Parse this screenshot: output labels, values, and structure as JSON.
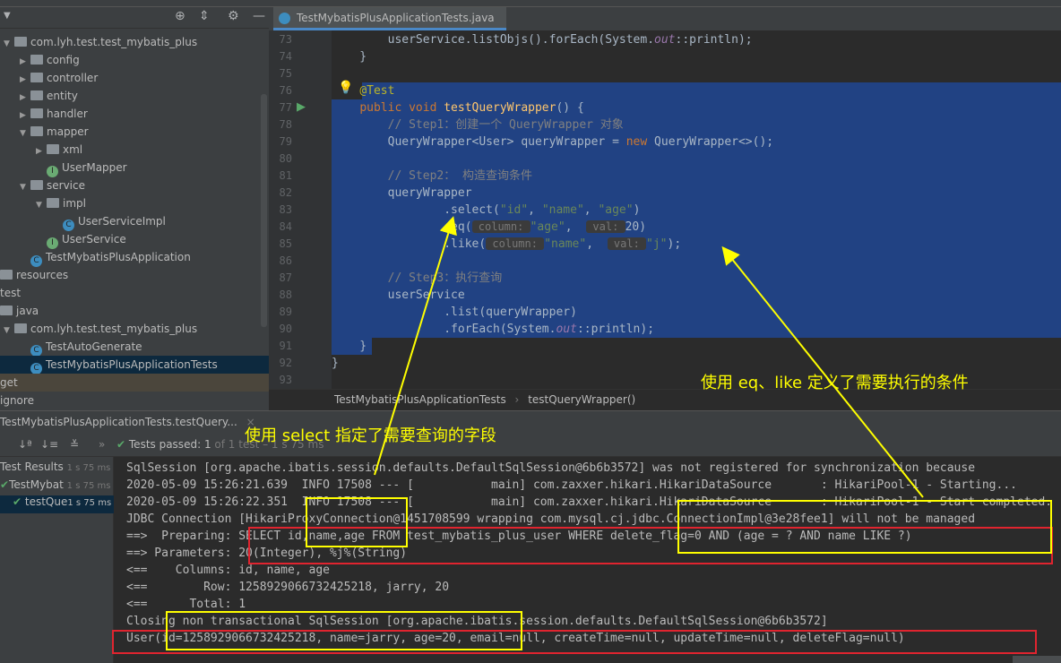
{
  "project": {
    "items": [
      {
        "label": "com.lyh.test.test_mybatis_plus",
        "depth": 0,
        "icon": "folder",
        "open": true
      },
      {
        "label": "config",
        "depth": 1,
        "icon": "folder"
      },
      {
        "label": "controller",
        "depth": 1,
        "icon": "folder"
      },
      {
        "label": "entity",
        "depth": 1,
        "icon": "folder"
      },
      {
        "label": "handler",
        "depth": 1,
        "icon": "folder"
      },
      {
        "label": "mapper",
        "depth": 1,
        "icon": "folder",
        "open": true
      },
      {
        "label": "xml",
        "depth": 2,
        "icon": "folder"
      },
      {
        "label": "UserMapper",
        "depth": 2,
        "icon": "interface",
        "leaf": true
      },
      {
        "label": "service",
        "depth": 1,
        "icon": "folder",
        "open": true
      },
      {
        "label": "impl",
        "depth": 2,
        "icon": "folder",
        "open": true
      },
      {
        "label": "UserServiceImpl",
        "depth": 3,
        "icon": "class",
        "leaf": true
      },
      {
        "label": "UserService",
        "depth": 2,
        "icon": "interface",
        "leaf": true
      },
      {
        "label": "TestMybatisPlusApplication",
        "depth": 1,
        "icon": "class",
        "leaf": true
      },
      {
        "label": "resources",
        "depth": -1,
        "icon": "folder",
        "leaf": true
      },
      {
        "label": "test",
        "depth": -2,
        "leaf": true
      },
      {
        "label": "java",
        "depth": -1,
        "icon": "folder",
        "leaf": true
      },
      {
        "label": "com.lyh.test.test_mybatis_plus",
        "depth": 0,
        "icon": "folder",
        "open": true
      },
      {
        "label": "TestAutoGenerate",
        "depth": 1,
        "icon": "class",
        "leaf": true
      },
      {
        "label": "TestMybatisPlusApplicationTests",
        "depth": 1,
        "icon": "class",
        "leaf": true,
        "selected": true
      },
      {
        "label": "get",
        "depth": -2,
        "leaf": true,
        "brown": true
      },
      {
        "label": "ignore",
        "depth": -2,
        "leaf": true
      }
    ]
  },
  "editor": {
    "tab": "TestMybatisPlusApplicationTests.java",
    "lines": [
      {
        "n": "73",
        "t": [
          [
            "        userService.listObjs().forEach(System.",
            ""
          ],
          [
            "out",
            "it"
          ],
          [
            "::println);",
            ""
          ]
        ]
      },
      {
        "n": "74",
        "t": [
          [
            "    }",
            ""
          ]
        ]
      },
      {
        "n": "75",
        "t": []
      },
      {
        "n": "76",
        "t": [
          [
            "    ",
            ""
          ],
          [
            "@Test",
            "an"
          ]
        ]
      },
      {
        "n": "77",
        "t": [
          [
            "    ",
            ""
          ],
          [
            "public void ",
            "kw"
          ],
          [
            "testQueryWrapper",
            "fn"
          ],
          [
            "() {",
            ""
          ]
        ]
      },
      {
        "n": "78",
        "t": [
          [
            "        // Step1：创建一个 QueryWrapper 对象",
            "cm"
          ]
        ]
      },
      {
        "n": "79",
        "t": [
          [
            "        QueryWrapper<User> queryWrapper = ",
            ""
          ],
          [
            "new ",
            "kw"
          ],
          [
            "QueryWrapper<>();",
            ""
          ]
        ]
      },
      {
        "n": "80",
        "t": []
      },
      {
        "n": "81",
        "t": [
          [
            "        // Step2： 构造查询条件",
            "cm"
          ]
        ]
      },
      {
        "n": "82",
        "t": [
          [
            "        queryWrapper",
            ""
          ]
        ]
      },
      {
        "n": "83",
        "t": [
          [
            "                .select(",
            ""
          ],
          [
            "\"id\"",
            "str"
          ],
          [
            ", ",
            ""
          ],
          [
            "\"name\"",
            "str"
          ],
          [
            ", ",
            ""
          ],
          [
            "\"age\"",
            "str"
          ],
          [
            ")",
            ""
          ]
        ]
      },
      {
        "n": "84",
        "t": [
          [
            "                .eq(",
            ""
          ],
          [
            " column: ",
            "hint"
          ],
          [
            "\"age\"",
            "str"
          ],
          [
            ",  ",
            ""
          ],
          [
            " val: ",
            "hint"
          ],
          [
            "20)",
            ""
          ]
        ]
      },
      {
        "n": "85",
        "t": [
          [
            "                .like(",
            ""
          ],
          [
            " column: ",
            "hint"
          ],
          [
            "\"name\"",
            "str"
          ],
          [
            ",  ",
            ""
          ],
          [
            " val: ",
            "hint"
          ],
          [
            "\"j\"",
            "str"
          ],
          [
            ");",
            ""
          ]
        ]
      },
      {
        "n": "86",
        "t": []
      },
      {
        "n": "87",
        "t": [
          [
            "        // Step3：执行查询",
            "cm"
          ]
        ]
      },
      {
        "n": "88",
        "t": [
          [
            "        userService",
            ""
          ]
        ]
      },
      {
        "n": "89",
        "t": [
          [
            "                .list(queryWrapper)",
            ""
          ]
        ]
      },
      {
        "n": "90",
        "t": [
          [
            "                .forEach(System.",
            ""
          ],
          [
            "out",
            "it"
          ],
          [
            "::println);",
            ""
          ]
        ]
      },
      {
        "n": "91",
        "t": [
          [
            "    }",
            ""
          ]
        ]
      },
      {
        "n": "92",
        "t": [
          [
            "}",
            ""
          ]
        ]
      },
      {
        "n": "93",
        "t": []
      }
    ],
    "breadcrumb": [
      "TestMybatisPlusApplicationTests",
      "testQueryWrapper()"
    ]
  },
  "run": {
    "tab": "TestMybatisPlusApplicationTests.testQuery...",
    "status": "Tests passed:",
    "count": "1",
    "detail": "of 1 test – 1 s 75 ms",
    "tests": [
      {
        "label": "Test Results",
        "time": "1 s 75 ms"
      },
      {
        "label": "TestMybat",
        "time": "1 s 75 ms"
      },
      {
        "label": "testQue",
        "time": "1 s 75 ms"
      }
    ],
    "console": [
      "SqlSession [org.apache.ibatis.session.defaults.DefaultSqlSession@6b6b3572] was not registered for synchronization because",
      "2020-05-09 15:26:21.639  INFO 17508 --- [           main] com.zaxxer.hikari.HikariDataSource       : HikariPool-1 - Starting...",
      "2020-05-09 15:26:22.351  INFO 17508 --- [           main] com.zaxxer.hikari.HikariDataSource       : HikariPool-1 - Start completed.",
      "JDBC Connection [HikariProxyConnection@1451708599 wrapping com.mysql.cj.jdbc.ConnectionImpl@3e28fee1] will not be managed",
      "==>  Preparing: SELECT id,name,age FROM test_mybatis_plus_user WHERE delete_flag=0 AND (age = ? AND name LIKE ?)",
      "==> Parameters: 20(Integer), %j%(String)",
      "<==    Columns: id, name, age",
      "<==        Row: 1258929066732425218, jarry, 20",
      "<==      Total: 1",
      "Closing non transactional SqlSession [org.apache.ibatis.session.defaults.DefaultSqlSession@6b6b3572]",
      "User(id=1258929066732425218, name=jarry, age=20, email=null, createTime=null, updateTime=null, deleteFlag=null)"
    ]
  },
  "annotations": {
    "select_note": "使用 select 指定了需要查询的字段",
    "eq_like_note": "使用 eq、like 定义了需要执行的条件",
    "colors": {
      "note": "#ffff00",
      "box_red": "#e0242f",
      "selection": "#214283"
    }
  }
}
